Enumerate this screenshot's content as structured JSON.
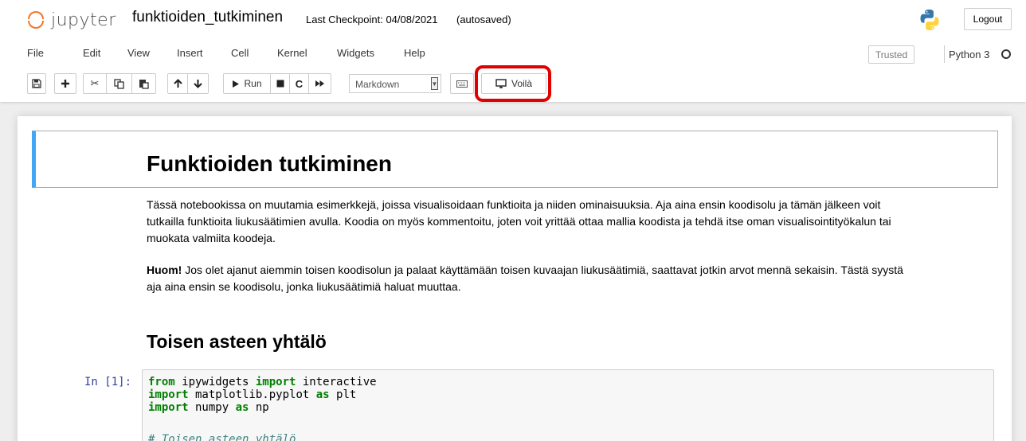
{
  "header": {
    "logo_text": "jupyter",
    "notebook_name": "funktioiden_tutkiminen",
    "checkpoint": "Last Checkpoint: 04/08/2021",
    "autosaved": "(autosaved)",
    "logout": "Logout"
  },
  "menubar": {
    "items": [
      "File",
      "Edit",
      "View",
      "Insert",
      "Cell",
      "Kernel",
      "Widgets",
      "Help"
    ],
    "trusted": "Trusted",
    "kernel": "Python 3"
  },
  "toolbar": {
    "run_label": "Run",
    "cell_type": "Markdown",
    "voila_label": "Voilà",
    "icons": [
      "save-icon",
      "plus-icon",
      "cut-icon",
      "copy-icon",
      "paste-icon",
      "arrow-up-icon",
      "arrow-down-icon",
      "play-icon",
      "stop-icon",
      "restart-icon",
      "fast-forward-icon",
      "keyboard-icon",
      "monitor-icon"
    ]
  },
  "notebook": {
    "title": "Funktioiden tutkiminen",
    "intro_lines": [
      "Tässä notebookissa on muutamia esimerkkejä, joissa visualisoidaan funktioita ja niiden ominaisuuksia. Aja aina ensin koodisolu ja tämän jälkeen voit",
      "tutkailla funktioita liukusäätimien avulla. Koodia on myös kommentoitu, joten voit yrittää ottaa mallia koodista ja tehdä itse oman visualisointityökalun tai",
      "muokata valmiita koodeja."
    ],
    "note_bold": "Huom!",
    "note_line1": " Jos olet ajanut aiemmin toisen koodisolun ja palaat käyttämään toisen kuvaajan liukusäätimiä, saattavat jotkin arvot mennä sekaisin. Tästä syystä",
    "note_line2": "aja aina ensin se koodisolu, jonka liukusäätimiä haluat muuttaa.",
    "section_title": "Toisen asteen yhtälö",
    "prompt": "In [1]:",
    "code": {
      "l1_kw1": "from",
      "l1_mod": " ipywidgets ",
      "l1_kw2": "import",
      "l1_name": " interactive",
      "l2_kw1": "import",
      "l2_mod": " matplotlib.pyplot ",
      "l2_kw2": "as",
      "l2_name": " plt",
      "l3_kw1": "import",
      "l3_mod": " numpy ",
      "l3_kw2": "as",
      "l3_name": " np",
      "l5_comment": "# Toisen asteen yhtälö"
    }
  },
  "colors": {
    "jupyter_orange": "#f37626",
    "selected_cell_bar": "#42a5f5",
    "highlight_red": "#e10000",
    "prompt_blue": "#303f9f",
    "keyword_green": "#008000"
  }
}
